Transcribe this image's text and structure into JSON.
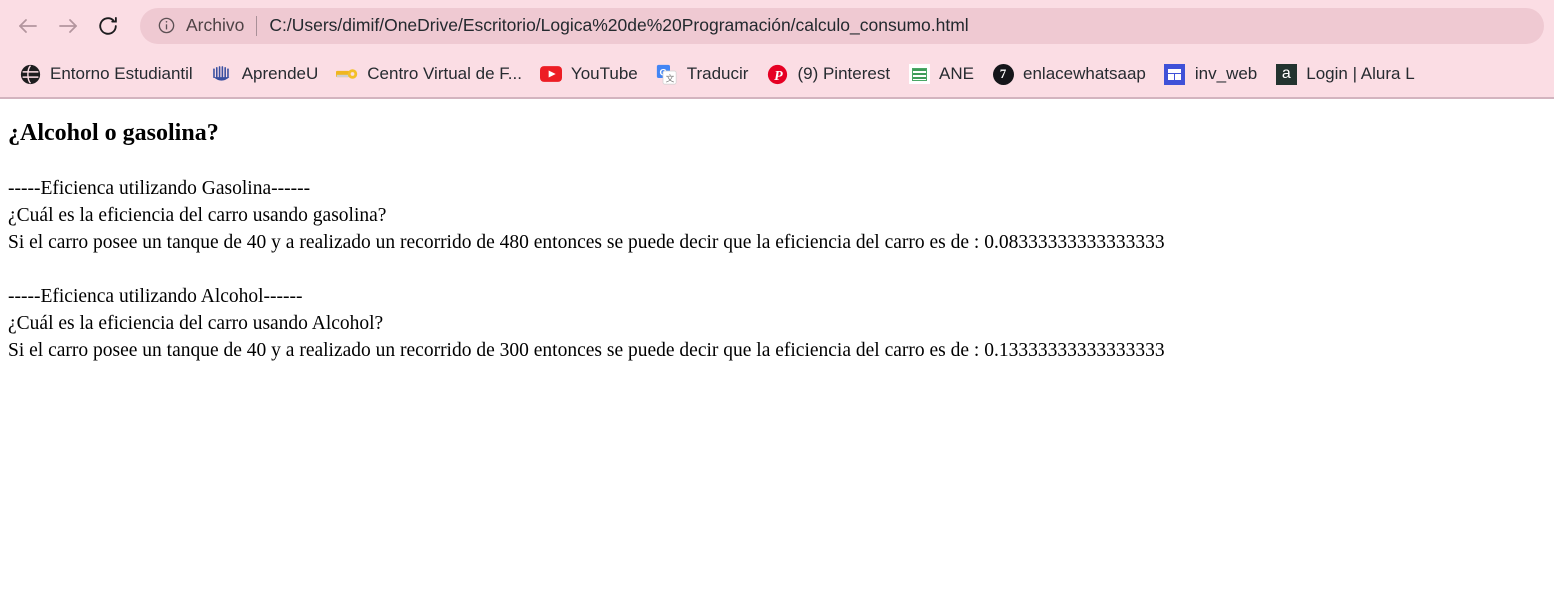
{
  "browser": {
    "nav": {
      "back_icon": "arrow-left-icon",
      "forward_icon": "arrow-right-icon",
      "reload_icon": "reload-icon"
    },
    "omnibox": {
      "info_icon": "info-circle-icon",
      "scheme_label": "Archivo",
      "url": "C:/Users/dimif/OneDrive/Escritorio/Logica%20de%20Programación/calculo_consumo.html"
    },
    "bookmarks": [
      {
        "label": "Entorno Estudiantil",
        "icon": "globe-icon"
      },
      {
        "label": "AprendeU",
        "icon": "aprendeu-fountain-icon"
      },
      {
        "label": "Centro Virtual de F...",
        "icon": "key-icon"
      },
      {
        "label": "YouTube",
        "icon": "youtube-icon"
      },
      {
        "label": "Traducir",
        "icon": "google-translate-icon"
      },
      {
        "label": "(9) Pinterest",
        "icon": "pinterest-icon"
      },
      {
        "label": "ANE",
        "icon": "ane-spreadsheet-icon"
      },
      {
        "label": "enlacewhatsaap",
        "icon": "whatsapp-link-icon"
      },
      {
        "label": "inv_web",
        "icon": "inv-web-icon"
      },
      {
        "label": "Login | Alura L",
        "icon": "alura-icon"
      }
    ],
    "colors": {
      "chrome_background": "#fbdde4",
      "omnibox_background": "#efc9d2",
      "chrome_border": "#d3b4bf",
      "page_background": "#ffffff"
    }
  },
  "page": {
    "title": "¿Alcohol o gasolina?",
    "gasolina": {
      "separator": "-----Eficienca utilizando Gasolina------",
      "question": "¿Cuál es la eficiencia del carro usando gasolina?",
      "result": "Si el carro posee un tanque de 40 y a realizado un recorrido de 480 entonces se puede decir que la eficiencia del carro es de : 0.08333333333333333",
      "tanque": "40",
      "recorrido": "480",
      "eficiencia": "0.08333333333333333"
    },
    "alcohol": {
      "separator": "-----Eficienca utilizando Alcohol------",
      "question": "¿Cuál es la eficiencia del carro usando Alcohol?",
      "result": "Si el carro posee un tanque de 40 y a realizado un recorrido de 300 entonces se puede decir que la eficiencia del carro es de : 0.13333333333333333",
      "tanque": "40",
      "recorrido": "300",
      "eficiencia": "0.13333333333333333"
    }
  }
}
